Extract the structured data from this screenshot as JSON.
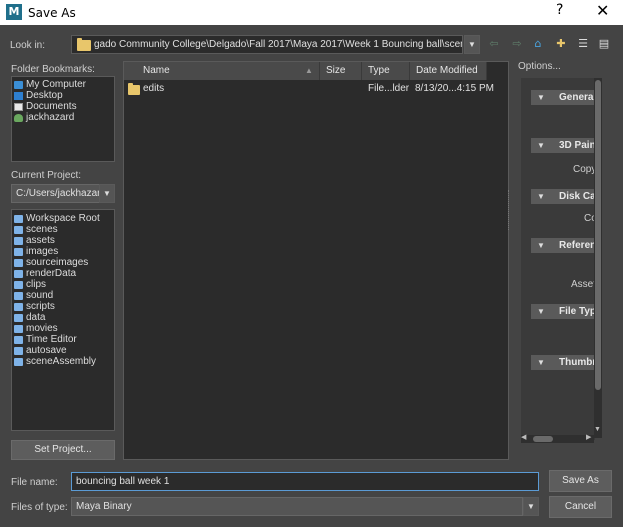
{
  "window": {
    "title": "Save As",
    "app_icon": "M",
    "help_label": "?",
    "close_label": "✕"
  },
  "look_in": {
    "label": "Look in:",
    "path": "gado Community College\\Delgado\\Fall 2017\\Maya 2017\\Week 1 Bouncing ball\\scenes"
  },
  "toolbar_icons": [
    "back-arrow-icon",
    "forward-arrow-icon",
    "home-icon",
    "new-folder-icon",
    "list-view-icon",
    "detail-view-icon"
  ],
  "bookmarks": {
    "label": "Folder Bookmarks:",
    "items": [
      {
        "label": "My Computer",
        "icon": "computer-icon"
      },
      {
        "label": "Desktop",
        "icon": "desktop-icon"
      },
      {
        "label": "Documents",
        "icon": "documents-icon"
      },
      {
        "label": "jackhazard",
        "icon": "user-icon"
      }
    ]
  },
  "project": {
    "label": "Current Project:",
    "value": "C:/Users/jackhazard",
    "items": [
      "Workspace Root",
      "scenes",
      "assets",
      "images",
      "sourceimages",
      "renderData",
      "clips",
      "sound",
      "scripts",
      "data",
      "movies",
      "Time Editor",
      "autosave",
      "sceneAssembly"
    ],
    "set_button": "Set Project..."
  },
  "file_list": {
    "columns": [
      "Name",
      "Size",
      "Type",
      "Date Modified"
    ],
    "rows": [
      {
        "name": "edits",
        "size": "",
        "type": "File...lder",
        "date": "8/13/20...4:15 PM"
      }
    ]
  },
  "options": {
    "label": "Options...",
    "sections": [
      {
        "title": "General",
        "sub": ""
      },
      {
        "title": "3D Pain",
        "sub": "Copy"
      },
      {
        "title": "Disk Ca",
        "sub": "Co"
      },
      {
        "title": "Referen",
        "sub": "Asset"
      },
      {
        "title": "File Typ",
        "sub": ""
      },
      {
        "title": "Thumbn",
        "sub": ""
      }
    ]
  },
  "bottom": {
    "file_name_label": "File name:",
    "file_name_value": "bouncing ball week 1",
    "file_type_label": "Files of type:",
    "file_type_value": "Maya Binary",
    "save_button": "Save As",
    "cancel_button": "Cancel"
  },
  "colors": {
    "folder": "#e8c66b",
    "active_border": "#5b9bd5",
    "background": "#444444",
    "panel": "#2b2b2b"
  }
}
